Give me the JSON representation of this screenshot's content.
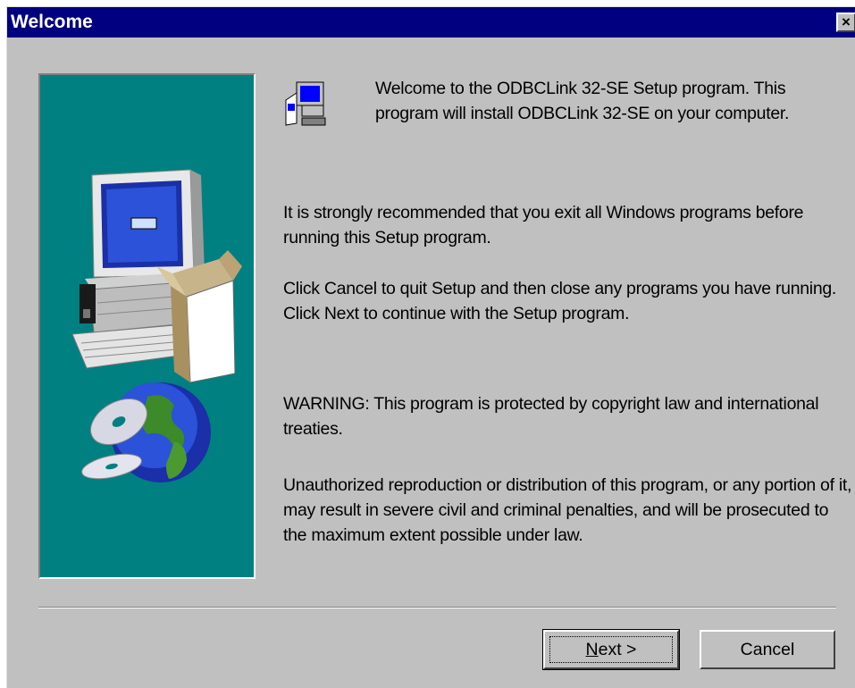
{
  "window": {
    "title": "Welcome",
    "close_label": "×"
  },
  "welcome_text": "Welcome to the ODBCLink 32-SE Setup program.  This program will install ODBCLink 32-SE on your computer.",
  "recommendation_text": "It is strongly recommended that you exit all Windows programs before running this Setup program.",
  "cancel_instructions_text": "Click Cancel to quit Setup and then close any programs you have running.  Click Next to continue with the Setup program.",
  "warning_text": "WARNING: This program is protected by copyright law and international treaties.",
  "unauthorized_text": "Unauthorized reproduction or distribution of this program, or any portion of it, may result in severe civil and criminal penalties, and will be prosecuted to the maximum extent possible under law.",
  "buttons": {
    "next_mnemonic": "N",
    "next_rest": "ext",
    "next_arrow": " >",
    "cancel": "Cancel"
  },
  "icons": {
    "setup": "computer-setup-icon",
    "close": "close-icon"
  },
  "colors": {
    "titlebar": "#000080",
    "panel": "#008080",
    "face": "#c0c0c0"
  }
}
